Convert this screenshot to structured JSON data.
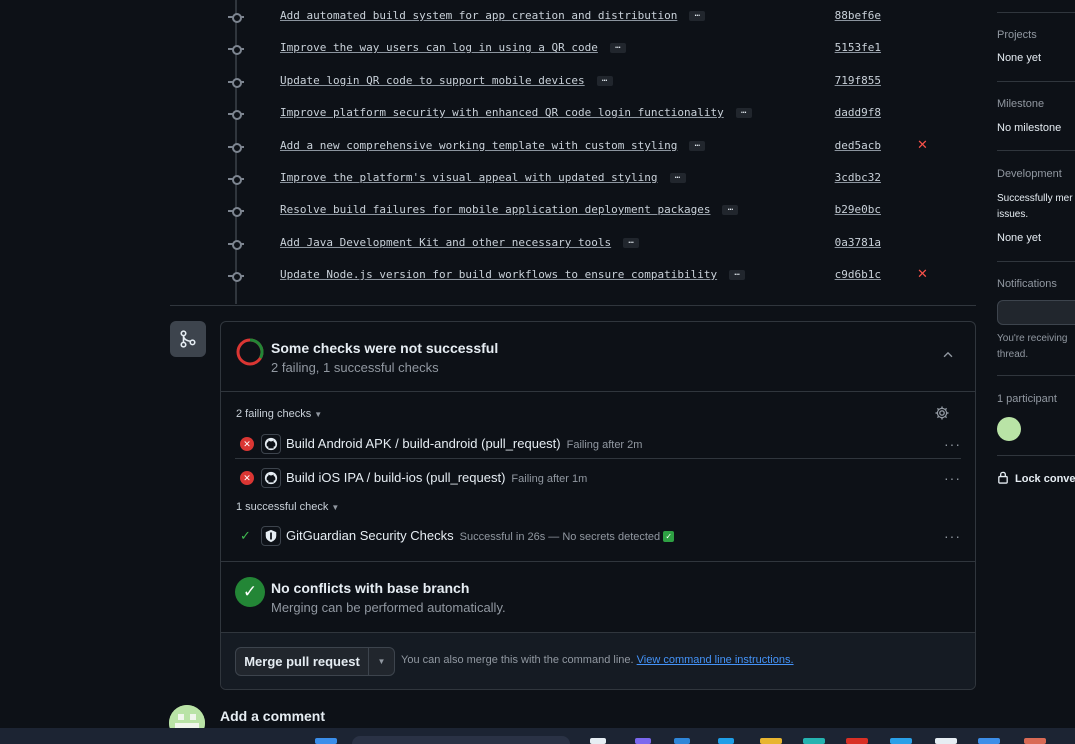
{
  "commits": [
    {
      "message": "Add automated build system for app creation and distribution",
      "sha": "88bef6e",
      "failed": false
    },
    {
      "message": "Improve the way users can log in using a QR code",
      "sha": "5153fe1",
      "failed": false
    },
    {
      "message": "Update login QR code to support mobile devices",
      "sha": "719f855",
      "failed": false
    },
    {
      "message": "Improve platform security with enhanced QR code login functionality",
      "sha": "dadd9f8",
      "failed": false
    },
    {
      "message": "Add a new comprehensive working template with custom styling",
      "sha": "ded5acb",
      "failed": true
    },
    {
      "message": "Improve the platform's visual appeal with updated styling",
      "sha": "3cdbc32",
      "failed": false
    },
    {
      "message": "Resolve build failures for mobile application deployment packages",
      "sha": "b29e0bc",
      "failed": false
    },
    {
      "message": "Add Java Development Kit and other necessary tools",
      "sha": "0a3781a",
      "failed": false
    },
    {
      "message": "Update Node.js version for build workflows to ensure compatibility",
      "sha": "c9d6b1c",
      "failed": true
    }
  ],
  "commit_ellipsis": "…",
  "fail_mark": "✕",
  "checks": {
    "title": "Some checks were not successful",
    "subtitle": "2 failing, 1 successful checks",
    "failing_label": "2 failing checks",
    "successful_label": "1 successful check",
    "failing": [
      {
        "name": "Build Android APK / build-android (pull_request)",
        "meta": "Failing after 2m"
      },
      {
        "name": "Build iOS IPA / build-ios (pull_request)",
        "meta": "Failing after 1m"
      }
    ],
    "successful": [
      {
        "name": "GitGuardian Security Checks",
        "meta": "Successful in 26s — No secrets detected"
      }
    ],
    "kebab": "···"
  },
  "conflicts": {
    "title": "No conflicts with base branch",
    "subtitle": "Merging can be performed automatically."
  },
  "merge": {
    "button_label": "Merge pull request",
    "hint": "You can also merge this with the command line.",
    "hint_link": "View command line instructions."
  },
  "comment": {
    "title": "Add a comment"
  },
  "sidebar": {
    "projects_label": "Projects",
    "projects_value": "None yet",
    "milestone_label": "Milestone",
    "milestone_value": "No milestone",
    "development_label": "Development",
    "development_note": "Successfully merged pull requests may close these issues.",
    "development_note_visible": "Successfully mer issues.",
    "development_value": "None yet",
    "notifications_label": "Notifications",
    "notifications_note": "You're receiving thread.",
    "participants_label": "1 participant",
    "lock_label": "Lock conver"
  },
  "colors": {
    "background": "#0d1117",
    "border": "#30363d",
    "fail_red": "#f85149",
    "success_green": "#238636",
    "link_blue": "#4493f8"
  }
}
